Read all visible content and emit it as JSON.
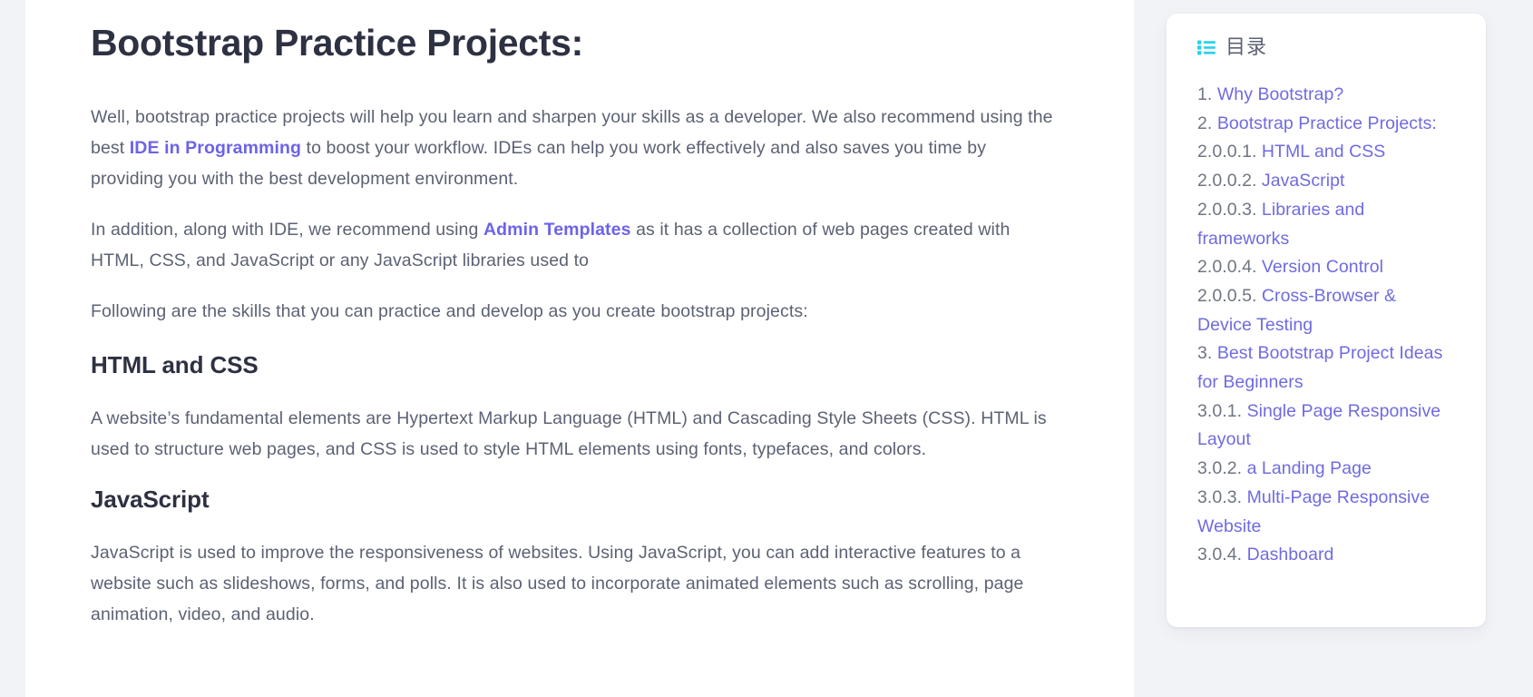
{
  "theme": {
    "page_background": "#f2f3f7",
    "card_background": "#ffffff",
    "heading_color": "#2d3142",
    "body_text_color": "#5c6274",
    "link_color": "#6c63e8",
    "toc_link_color": "#6f6be0",
    "toc_number_color": "#6f7582",
    "toc_icon_color": "#2ad2ec"
  },
  "article": {
    "title": "Bootstrap Practice Projects:",
    "paragraphs": [
      {
        "id": "intro",
        "parts": [
          {
            "type": "text",
            "value": "Well, bootstrap practice projects will help you learn and sharpen your skills as a developer. We also recommend using the best "
          },
          {
            "type": "link",
            "value": "IDE in Programming"
          },
          {
            "type": "text",
            "value": " to boost your workflow. IDEs can help you work effectively and also saves you time by providing you with the best development environment."
          }
        ]
      },
      {
        "id": "admin-templates",
        "parts": [
          {
            "type": "text",
            "value": "In addition, along with IDE, we recommend using "
          },
          {
            "type": "link",
            "value": "Admin Templates"
          },
          {
            "type": "text",
            "value": " as it has a collection of web pages created with HTML, CSS, and JavaScript or any JavaScript libraries used to"
          }
        ]
      },
      {
        "id": "skills-lead",
        "parts": [
          {
            "type": "text",
            "value": "Following are the skills that you can practice and develop as you create bootstrap projects:"
          }
        ]
      }
    ],
    "sections": [
      {
        "heading": "HTML and CSS",
        "body": "A website’s fundamental elements are Hypertext Markup Language (HTML) and Cascading Style Sheets (CSS). HTML is used to structure web pages, and CSS is used to style HTML elements using fonts, typefaces, and colors."
      },
      {
        "heading": "JavaScript",
        "body": "JavaScript is used to improve the responsiveness of websites. Using JavaScript, you can add interactive features to a website such as slideshows, forms, and polls. It is also used to incorporate animated elements such as scrolling, page animation, video, and audio."
      }
    ]
  },
  "toc": {
    "icon_name": "list-bullets-icon",
    "title": "目录",
    "items": [
      {
        "number": "1.",
        "label": "Why Bootstrap?"
      },
      {
        "number": "2.",
        "label": "Bootstrap Practice Projects:"
      },
      {
        "number": "2.0.0.1.",
        "label": "HTML and CSS"
      },
      {
        "number": "2.0.0.2.",
        "label": "JavaScript"
      },
      {
        "number": "2.0.0.3.",
        "label": "Libraries and frameworks"
      },
      {
        "number": "2.0.0.4.",
        "label": "Version Control"
      },
      {
        "number": "2.0.0.5.",
        "label": "Cross-Browser & Device Testing"
      },
      {
        "number": "3.",
        "label": "Best Bootstrap Project Ideas for Beginners"
      },
      {
        "number": "3.0.1.",
        "label": "Single Page Responsive Layout"
      },
      {
        "number": "3.0.2.",
        "label": "a Landing Page"
      },
      {
        "number": "3.0.3.",
        "label": "Multi-Page Responsive Website"
      },
      {
        "number": "3.0.4.",
        "label": "Dashboard"
      }
    ]
  }
}
